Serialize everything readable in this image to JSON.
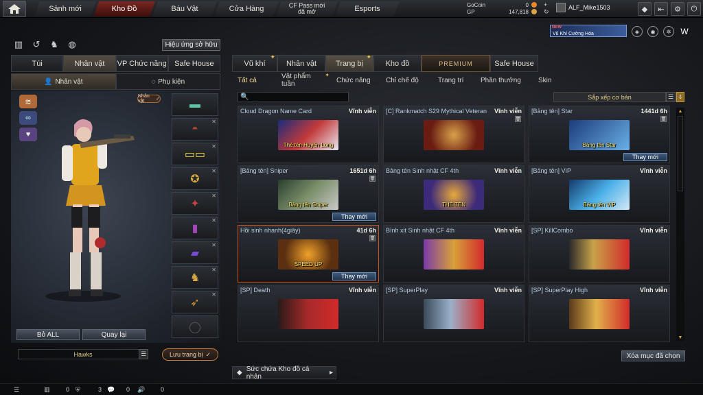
{
  "topnav": {
    "tabs": [
      "Sảnh mới",
      "Kho Đồ",
      "Báu Vật",
      "Cửa Hàng",
      "CF Pass mới đã mở",
      "Esports"
    ],
    "active_index": 1
  },
  "currency": {
    "gocoin_label": "GoCoin",
    "gocoin_value": "0",
    "gp_label": "GP",
    "gp_value": "147,818"
  },
  "user": {
    "name": "ALF_Mike1503"
  },
  "banner": {
    "badge": "NEW",
    "text": "Vũ Khí Cường Hóa"
  },
  "left": {
    "effect_button": "Hiệu ứng sở hữu",
    "tabs": [
      "Túi",
      "Nhân vật",
      "VP Chức năng",
      "Safe House"
    ],
    "active_tab": 1,
    "subtabs": [
      "Nhân vật",
      "Phụ kiện"
    ],
    "char_badge": "Nhân vật",
    "remove_all": "Bỏ ALL",
    "back": "Quay lại",
    "clan_name": "Hawks",
    "save_button": "Lưu trang bị"
  },
  "right": {
    "tabs": [
      "Vũ khí",
      "Nhân vật",
      "Trang bị",
      "Kho đồ",
      "PREMIUM",
      "Safe House"
    ],
    "active_tab": 2,
    "filters": [
      "Tất cả",
      "Vật phẩm tuần",
      "Chức năng",
      "Chỉ chế độ",
      "Trang trí",
      "Phần thưởng",
      "Skin"
    ],
    "active_filter": 0,
    "sort_label": "Sắp xếp cơ bản",
    "items": [
      {
        "name": "Cloud Dragon Name Card",
        "duration": "Vĩnh viễn",
        "art_label": "Thẻ tên Huyền Long",
        "change": ""
      },
      {
        "name": "[C] Rankmatch S29 Mythical Veteran",
        "duration": "Vĩnh viễn",
        "art_label": "",
        "change": ""
      },
      {
        "name": "[Bảng tên] Star",
        "duration": "1441d 6h",
        "art_label": "Bảng tên Star",
        "change": "Thay mới"
      },
      {
        "name": "[Bảng tên] Sniper",
        "duration": "1651d 6h",
        "art_label": "Bảng tên Sniper",
        "change": "Thay mới"
      },
      {
        "name": "Bảng tên Sinh nhật CF 4th",
        "duration": "Vĩnh viễn",
        "art_label": "THẺ TÊN",
        "change": ""
      },
      {
        "name": "[Bảng tên] VIP",
        "duration": "Vĩnh viễn",
        "art_label": "Bảng tên VIP",
        "change": ""
      },
      {
        "name": "Hồi sinh nhanh(4giây)",
        "duration": "41d 6h",
        "art_label": "SPEED UP",
        "change": "Thay mới"
      },
      {
        "name": "Bình xịt Sinh nhật CF 4th",
        "duration": "Vĩnh viễn",
        "art_label": "",
        "change": ""
      },
      {
        "name": "[SP] KillCombo",
        "duration": "Vĩnh viễn",
        "art_label": "",
        "change": ""
      },
      {
        "name": "[SP] Death",
        "duration": "Vĩnh viễn",
        "art_label": "",
        "change": ""
      },
      {
        "name": "[SP] SuperPlay",
        "duration": "Vĩnh viễn",
        "art_label": "",
        "change": ""
      },
      {
        "name": "[SP] SuperPlay High",
        "duration": "Vĩnh viễn",
        "art_label": "",
        "change": ""
      }
    ],
    "clear_button": "Xóa mục đã chọn",
    "storage_label": "Sức chứa Kho đồ cá nhân"
  },
  "statusbar": {
    "friends": "0",
    "clan": "3",
    "chat": "0",
    "voice": "0"
  }
}
